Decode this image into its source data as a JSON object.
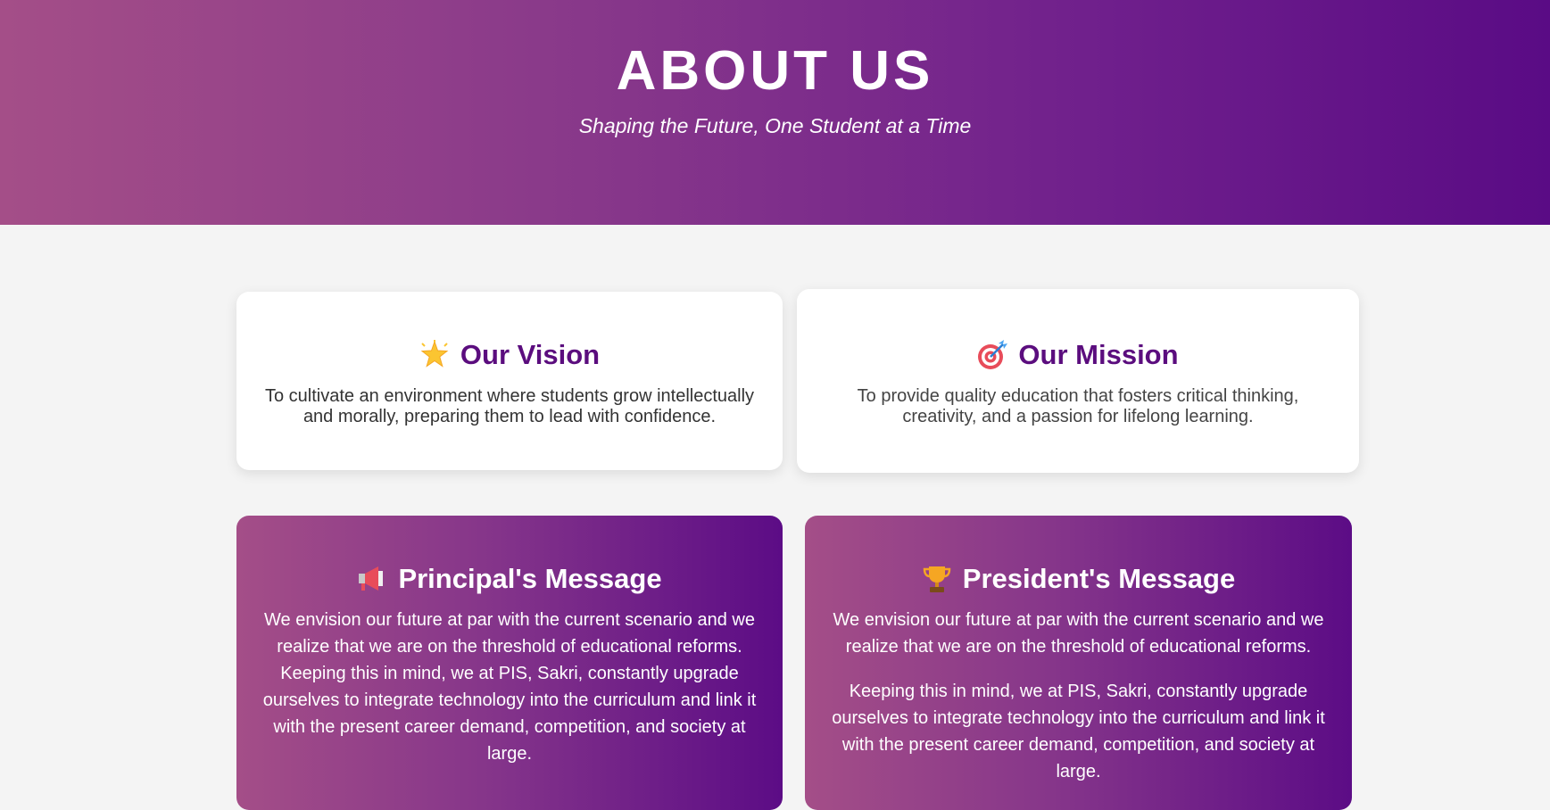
{
  "hero": {
    "title": "ABOUT US",
    "subtitle": "Shaping the Future, One Student at a Time"
  },
  "vision": {
    "icon": "glowing-star-icon",
    "title": "Our Vision",
    "text": "To cultivate an environment where students grow intellectually and morally, preparing them to lead with confidence."
  },
  "mission": {
    "icon": "target-icon",
    "title": "Our Mission",
    "text": "To provide quality education that fosters critical thinking, creativity, and a passion for lifelong learning."
  },
  "principal": {
    "icon": "megaphone-icon",
    "title": "Principal's Message",
    "text": "We envision our future at par with the current scenario and we realize that we are on the threshold of educational reforms. Keeping this in mind, we at PIS, Sakri, constantly upgrade ourselves to integrate technology into the curriculum and link it with the present career demand, competition, and society at large."
  },
  "president": {
    "icon": "trophy-icon",
    "title": "President's Message",
    "paragraphs": [
      "We envision our future at par with the current scenario and we realize that we are on the threshold of educational reforms.",
      "Keeping this in mind, we at PIS, Sakri, constantly upgrade ourselves to integrate technology into the curriculum and link it with the present career demand, competition, and society at large."
    ]
  },
  "colors": {
    "brand_purple": "#5b0d7e",
    "gradient_start": "#a44e88",
    "gradient_end": "#5a0b85",
    "page_background": "#f4f4f4"
  }
}
